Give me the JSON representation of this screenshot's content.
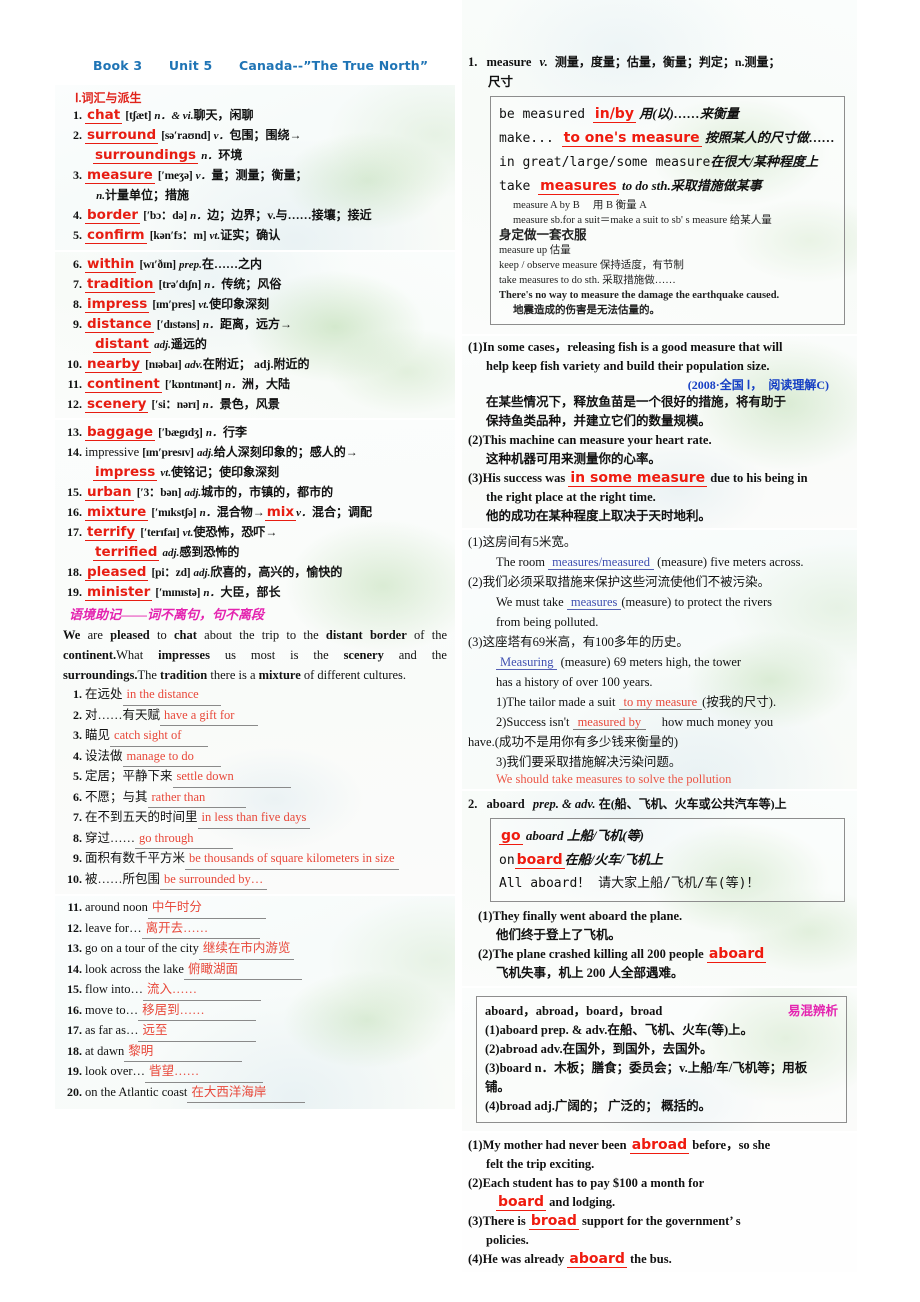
{
  "header": {
    "book": "Book 3",
    "unit": "Unit 5",
    "topic": "Canada--”The True North”"
  },
  "left": {
    "section1_title": "Ⅰ.词汇与派生",
    "vocab": [
      {
        "n": "1.",
        "word": "chat",
        "phonetic": "[tʃæt]",
        "pos": "n．& vi.",
        "cn": "聊天，闲聊"
      },
      {
        "n": "2.",
        "word": "surround",
        "phonetic": "[sə′raʊnd]",
        "pos": "v．",
        "cn": "包围；围绕→"
      },
      {
        "n": "",
        "word": "surroundings",
        "phonetic": "",
        "pos": "n．",
        "cn": "环境",
        "sub": true
      },
      {
        "n": "3.",
        "word": "measure",
        "phonetic": "[′meʒə]",
        "pos": "v．",
        "cn": "量；测量；衡量；"
      },
      {
        "n": "",
        "word": "",
        "phonetic": "",
        "pos": "n.",
        "cn": "计量单位；措施",
        "sub": true,
        "plain": true
      },
      {
        "n": "4.",
        "word": "border",
        "phonetic": "[′bɔ：də]",
        "pos": "n．",
        "cn": "边；边界；v.与……接壤；接近"
      },
      {
        "n": "5.",
        "word": "confirm",
        "phonetic": "[kən′fɜ：m]",
        "pos": "vt.",
        "cn": "证实；确认"
      },
      {
        "n": "6.",
        "word": "within",
        "phonetic": "[wɪ′ðɪn]",
        "pos": "prep.",
        "cn": "在……之内"
      },
      {
        "n": "7.",
        "word": "tradition",
        "phonetic": "[trə′dɪʃn]",
        "pos": "n．",
        "cn": "传统；风俗"
      },
      {
        "n": "8.",
        "word": "impress",
        "phonetic": "[ɪm′pres]",
        "pos": "vt.",
        "cn": "使印象深刻"
      },
      {
        "n": "9.",
        "word": "distance",
        "phonetic": "[′dɪstəns]",
        "pos": "n．",
        "cn": "距离，远方→"
      },
      {
        "n": "",
        "word": "distant",
        "phonetic": "",
        "pos": "adj.",
        "cn": "遥远的",
        "sub": true
      },
      {
        "n": "10.",
        "word": "nearby",
        "phonetic": "[nɪəbaɪ]",
        "pos": "adv.",
        "cn": "在附近； adj.附近的"
      },
      {
        "n": "11.",
        "word": "continent",
        "phonetic": "[′kɒntɪnənt]",
        "pos": "n．",
        "cn": "洲，大陆"
      },
      {
        "n": "12.",
        "word": "scenery",
        "phonetic": "[′si：nərɪ]",
        "pos": "n．",
        "cn": "景色，风景"
      },
      {
        "n": "13.",
        "word": "baggage",
        "phonetic": "[′bægɪdʒ]",
        "pos": "n．",
        "cn": "行李"
      },
      {
        "n": "14.",
        "word": "impressive",
        "phonetic": "[ɪm′presɪv]",
        "pos": "adj.",
        "cn": "给人深刻印象的；感人的→",
        "plain": true
      },
      {
        "n": "",
        "word": "impress",
        "phonetic": "",
        "pos": "vt.",
        "cn": "使铭记；使印象深刻",
        "sub": true
      },
      {
        "n": "15.",
        "word": "urban",
        "phonetic": "[′3：bən]",
        "pos": "adj.",
        "cn": "城市的，市镇的，都市的"
      },
      {
        "n": "16.",
        "word": "mixture",
        "phonetic": "[′mɪkstʃə]",
        "pos": "n．",
        "cn": "混合物→",
        "extra_kw": "mix",
        "extra_pos": "v．",
        "extra_cn": "混合；调配"
      },
      {
        "n": "17.",
        "word": "terrify",
        "phonetic": "[′terɪfaɪ]",
        "pos": "vt.",
        "cn": "使恐怖，恐吓→"
      },
      {
        "n": "",
        "word": "terrified",
        "phonetic": "",
        "pos": "adj.",
        "cn": "感到恐怖的",
        "sub": true
      },
      {
        "n": "18.",
        "word": "pleased",
        "phonetic": "[pi：zd]",
        "pos": "adj.",
        "cn": "欣喜的，高兴的，愉快的"
      },
      {
        "n": "19.",
        "word": "minister",
        "phonetic": "[′mɪnɪstə]",
        "pos": "n．",
        "cn": "大臣，部长"
      }
    ],
    "memo_title": "语境助记——词不离句，句不离段",
    "memo_paragraph_html": "<b>We</b> are <b>pleased</b> to <b>chat</b> about the trip to the <b>distant border</b> of the <b>continent.</b>What <b>impresses</b> us most is the <b>scenery</b> and the <b>surroundings.</b>The <b>tradition</b> there is a <b>mixture</b> of different cultures.",
    "phrases": [
      {
        "n": "1.",
        "cue": "在远处",
        "ans": "in the distance",
        "cue_first": true,
        "w": "w1"
      },
      {
        "n": "2.",
        "cue": "对……有天赋",
        "ans": "have a gift for",
        "cue_first": true,
        "w": "w1"
      },
      {
        "n": "3.",
        "cue": "瞄见",
        "ans": "catch sight of",
        "cue_first": true,
        "w": "w1"
      },
      {
        "n": "4.",
        "cue": "设法做",
        "ans": "manage to do",
        "cue_first": true,
        "w": "w1"
      },
      {
        "n": "5.",
        "cue": "定居；平静下来",
        "ans": "settle down",
        "cue_first": true,
        "w": "w2"
      },
      {
        "n": "6.",
        "cue": "不愿；与其",
        "ans": "rather than",
        "cue_first": true,
        "w": "w1"
      },
      {
        "n": "7.",
        "cue": "在不到五天的时间里",
        "ans": "in less than five days",
        "cue_first": true,
        "w": "auto"
      },
      {
        "n": "8.",
        "cue": "穿过……",
        "ans": "go through",
        "cue_first": true,
        "w": "w1"
      },
      {
        "n": "9.",
        "cue": "面积有数千平方米",
        "ans": "be thousands of square kilometers in size",
        "cue_first": true,
        "w": "auto"
      },
      {
        "n": "10.",
        "cue": "被……所包围",
        "ans": "be surrounded by…",
        "cue_first": true,
        "w": "auto"
      },
      {
        "n": "11.",
        "cue": "around noon",
        "ans": "中午时分",
        "cue_first": true,
        "w": "w2",
        "cn_ans": true
      },
      {
        "n": "12.",
        "cue": "leave for…",
        "ans": "离开去……",
        "cue_first": true,
        "w": "w2",
        "cn_ans": true
      },
      {
        "n": "13.",
        "cue": "go on a tour of the city",
        "ans": "继续在市内游览",
        "cue_first": true,
        "w": "auto",
        "cn_ans": true
      },
      {
        "n": "14.",
        "cue": "look across the lake",
        "ans": "俯瞰湖面",
        "cue_first": true,
        "w": "w2",
        "cn_ans": true
      },
      {
        "n": "15.",
        "cue": "flow into…",
        "ans": "流入……",
        "cue_first": true,
        "w": "w2",
        "cn_ans": true
      },
      {
        "n": "16.",
        "cue": "move to…",
        "ans": "移居到……",
        "cue_first": true,
        "w": "w2",
        "cn_ans": true
      },
      {
        "n": "17.",
        "cue": "as far as…",
        "ans": "远至",
        "cue_first": true,
        "w": "w2",
        "cn_ans": true
      },
      {
        "n": "18.",
        "cue": "at dawn",
        "ans": "黎明",
        "cue_first": true,
        "w": "w2",
        "cn_ans": true
      },
      {
        "n": "19.",
        "cue": "look over…",
        "ans": "眥望……",
        "cue_first": true,
        "w": "w2",
        "cn_ans": true
      },
      {
        "n": "20.",
        "cue": "on the Atlantic coast",
        "ans": "在大西洋海岸",
        "cue_first": true,
        "w": "w2",
        "cn_ans": true
      }
    ]
  },
  "right": {
    "entry1": {
      "num": "1.",
      "headword": "measure",
      "pos": "v.",
      "def_line1": "测量，度量；估量，衡量；判定；n.测量；",
      "def_line2": "尺寸",
      "box": [
        {
          "pre": "be measured ",
          "kw": "in/by",
          "post": " 用(以)……来衡量"
        },
        {
          "pre": "make... ",
          "kw": "to one's measure",
          "post": " 按照某人的尺寸做……"
        },
        {
          "pre": "in great/large/some measure",
          "kw": "",
          "post": "在很大/某种程度上"
        },
        {
          "pre": "take ",
          "kw": "measures",
          "post": " to do sth.采取措施做某事"
        }
      ],
      "box_notes": [
        {
          "t": "measure A by B 　用 B 衡量 A",
          "ind": true
        },
        {
          "t": "measure sb.for a suit＝make a suit to sb' s measure 给某人量",
          "ind": true
        },
        {
          "t": "身定做一套衣服",
          "ind": false,
          "big": true
        },
        {
          "t": "measure up 估量",
          "ind": false
        },
        {
          "t": "keep / observe measure 保持适度，有节制",
          "ind": false
        },
        {
          "t": "take measures to do sth. 采取措施做……",
          "ind": false
        },
        {
          "t": "There's no way to measure the damage the earthquake caused.",
          "ind": false,
          "bold": true
        },
        {
          "t": "地震造成的伤害是无法估量的。",
          "ind": true,
          "bold": true
        }
      ],
      "examples": [
        {
          "label": "(1)",
          "en_pre": "In some cases，releasing fish is a good measure that will",
          "en_2": "help keep fish variety and build their population size.",
          "source": "(2008·全国 Ⅰ，　阅读理解C)",
          "cn_1": "在某些情况下，释放鱼苗是一个很好的措施，将有助于",
          "cn_2": "保持鱼类品种，并建立它们的数量规模。"
        },
        {
          "label": "(2)",
          "en_pre": "This machine can measure your heart rate.",
          "cn_1": "这种机器可用来测量你的心率。"
        },
        {
          "label": "(3)",
          "en_pre": "His success was ",
          "hl": "in some measure",
          "en_post": " due to his being in",
          "en_2": "the right place at the right time.",
          "cn_1": "他的成功在某种程度上取决于天时地利。"
        }
      ],
      "exercises": [
        {
          "label": "(1)",
          "cn": "这房间有5米宽。",
          "en_pre": "The room ",
          "fill": "measures/measured",
          "en_post": " (measure) five meters across."
        },
        {
          "label": "(2)",
          "cn": "我们必须采取措施来保护这些河流使他们不被污染。",
          "en_pre": "We must take ",
          "fill": "measures",
          "en_post": "(measure) to protect the rivers",
          "en_2": "from being polluted."
        },
        {
          "label": "(3)",
          "cn": "这座塔有69米高，有100多年的历史。",
          "fill_first": "Measuring",
          "en_post": " (measure) 69 meters high, the tower",
          "en_2": "has a history of over 100 years."
        }
      ],
      "sub_exercises": [
        {
          "label": "1)",
          "pre": "The tailor made a suit ",
          "fill": "to my measure",
          "post": "(按我的尺寸)."
        },
        {
          "label": "2)",
          "pre": "Success isn't ",
          "fill": "measured by",
          "post": " 　how much money you",
          "wrap": "have.(成功不是用你有多少钱来衡量的)"
        },
        {
          "label": "3)",
          "pre": "我们要采取措施解决污染问题。",
          "answer": "We should take measures to solve the pollution"
        }
      ]
    },
    "entry2": {
      "num": "2.",
      "headword": "aboard",
      "pos": "prep. & adv.",
      "def_line1": "在(船、飞机、火车或公共汽车等)上",
      "box": [
        {
          "kw": "go",
          "post": " aboard 上船/飞机(等)"
        },
        {
          "pre": "on",
          "kw": "board",
          "post": "在船/火车/飞机上"
        },
        {
          "pre": "All  aboard！ 请大家上船/飞机/车(等)！",
          "kw": "",
          "post": ""
        }
      ],
      "examples": [
        {
          "label": "(1)",
          "en_pre": "They finally went aboard the plane.",
          "cn_1": "他们终于登上了飞机。"
        },
        {
          "label": "(2)",
          "en_pre": "The plane crashed killing all 200 people ",
          "hl": "aboard",
          "cn_1": "飞机失事，机上 200 人全部遇难。"
        }
      ],
      "compare_box": {
        "title": "aboard，abroad，board，broad",
        "badge": "易混辨析",
        "items": [
          "(1)aboard prep. & adv.在船、飞机、火车(等)上。",
          "(2)abroad adv.在国外，到国外，去国外。",
          "(3)board n．木板；膳食；委员会；v.上船/车/飞机等；用板",
          "铺。",
          "(4)broad adj.广阔的； 广泛的； 概括的。"
        ]
      },
      "final_exercises": [
        {
          "label": "(1)",
          "pre": "My mother had never been ",
          "fill": "abroad",
          "post": " before，so she",
          "line2": "felt the trip exciting."
        },
        {
          "label": "(2)",
          "pre": "Each student has to pay $100 a month for",
          "line2_fill": "board",
          "line2_post": " and lodging."
        },
        {
          "label": "(3)",
          "pre": "There is ",
          "fill": "broad",
          "post": " support for the government’ s",
          "line2": "policies."
        },
        {
          "label": "(4)",
          "pre": "He was already ",
          "fill": "aboard",
          "post": " the bus."
        }
      ]
    }
  }
}
